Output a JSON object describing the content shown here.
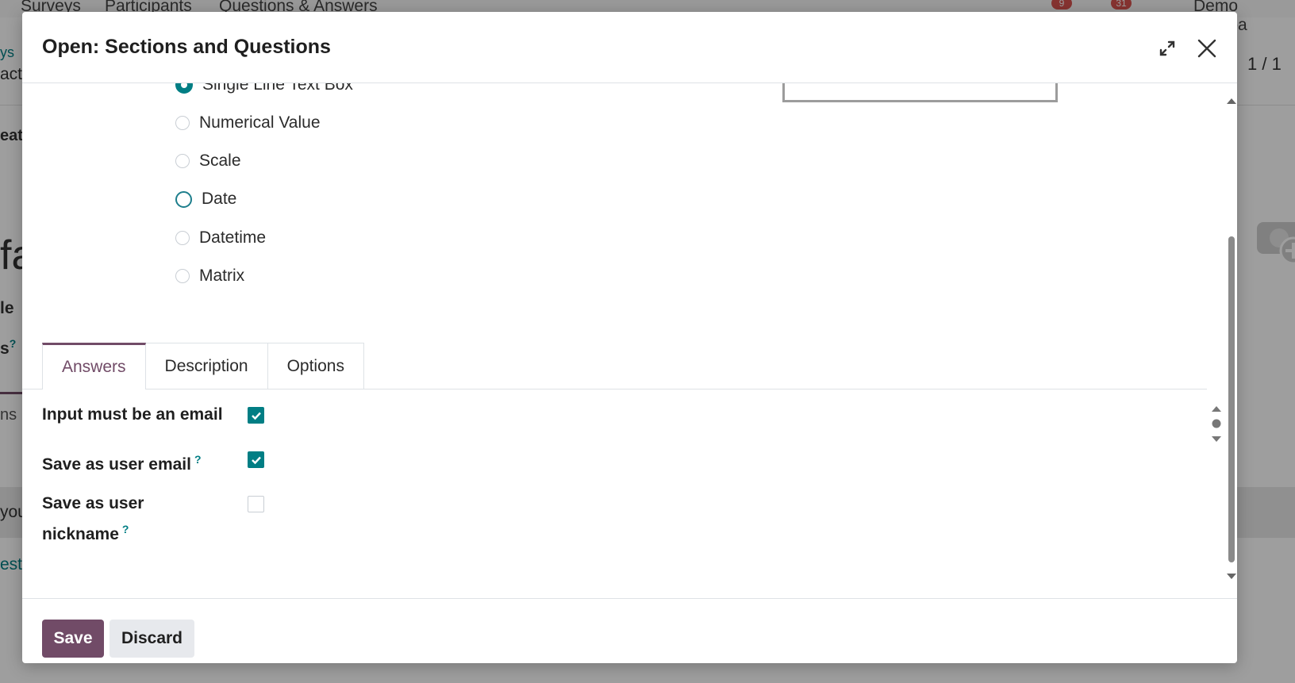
{
  "background": {
    "nav_items": [
      "Surveys",
      "Participants",
      "Questions & Answers"
    ],
    "company": "Demo Compa",
    "badges": [
      "9",
      "31"
    ],
    "pager": "1 / 1",
    "fragments": [
      "ys",
      "acti",
      "eate",
      "fa",
      "le",
      "s",
      "ns",
      "you",
      "est"
    ],
    "help_mark": "?"
  },
  "modal": {
    "title": "Open: Sections and Questions",
    "expand_icon": "expand-icon",
    "close_icon": "close-icon"
  },
  "question_types": [
    {
      "label": "Single Line Text Box",
      "state": "checked"
    },
    {
      "label": "Numerical Value",
      "state": "off"
    },
    {
      "label": "Scale",
      "state": "off"
    },
    {
      "label": "Date",
      "state": "focus"
    },
    {
      "label": "Datetime",
      "state": "off"
    },
    {
      "label": "Matrix",
      "state": "off"
    }
  ],
  "tabs": [
    {
      "label": "Answers",
      "active": true
    },
    {
      "label": "Description",
      "active": false
    },
    {
      "label": "Options",
      "active": false
    }
  ],
  "fields": {
    "input_email": {
      "label": "Input must be an email",
      "checked": true
    },
    "save_email": {
      "label": "Save as user email",
      "help": "?",
      "checked": true
    },
    "save_nickname": {
      "label_line1": "Save as user",
      "label_line2": "nickname",
      "help": "?",
      "checked": false
    }
  },
  "footer": {
    "save_label": "Save",
    "discard_label": "Discard"
  },
  "colors": {
    "primary": "#714b67",
    "teal": "#017e84"
  }
}
